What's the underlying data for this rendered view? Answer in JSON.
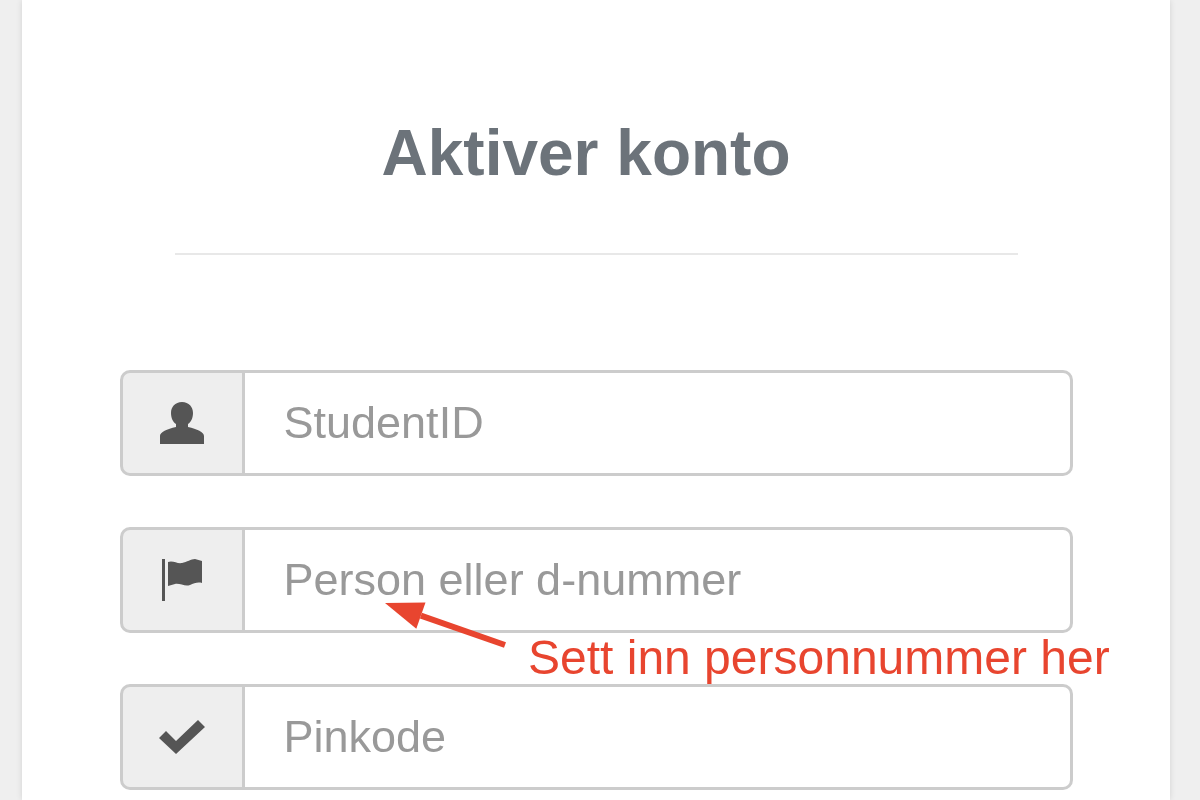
{
  "title": "Aktiver konto",
  "fields": [
    {
      "placeholder": "StudentID"
    },
    {
      "placeholder": "Person eller d-nummer"
    },
    {
      "placeholder": "Pinkode"
    }
  ],
  "annotation": {
    "text": "Sett inn personnummer her"
  }
}
